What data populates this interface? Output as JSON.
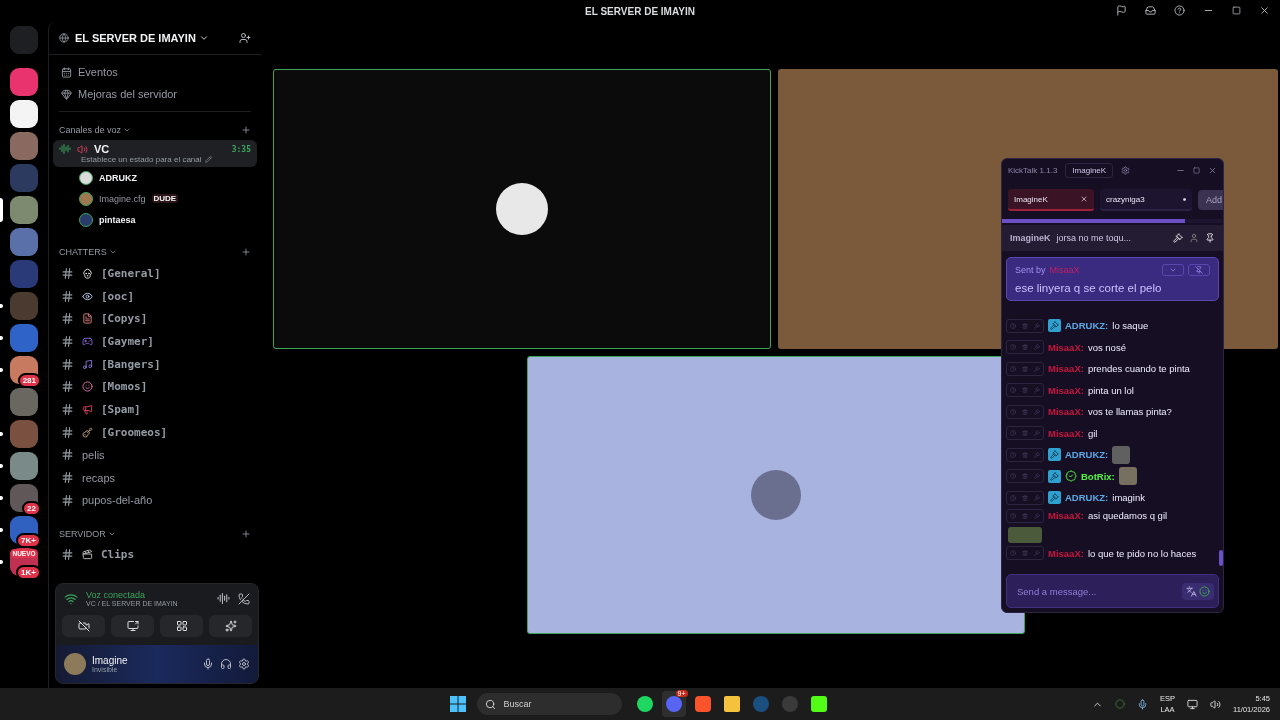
{
  "titlebar": {
    "title": "EL SERVER DE IMAYIN"
  },
  "servers": [
    {
      "selected": false,
      "unread": false
    },
    {
      "selected": false,
      "unread": false
    },
    {
      "selected": false,
      "unread": false
    },
    {
      "selected": false,
      "unread": false
    },
    {
      "selected": true,
      "unread": false
    },
    {
      "selected": false,
      "unread": false
    },
    {
      "selected": false,
      "unread": false
    },
    {
      "selected": false,
      "unread": true
    },
    {
      "selected": false,
      "unread": true
    },
    {
      "selected": false,
      "unread": true,
      "badge": "281"
    },
    {
      "selected": false,
      "unread": false
    },
    {
      "selected": false,
      "unread": true
    },
    {
      "selected": false,
      "unread": true
    },
    {
      "selected": false,
      "unread": true,
      "badge": "22"
    },
    {
      "selected": false,
      "unread": true,
      "badge": "7K+"
    },
    {
      "selected": false,
      "unread": true,
      "badge": "1K+",
      "tag": "NUEVO"
    }
  ],
  "server": {
    "name": "EL SERVER DE IMAYIN",
    "menu": [
      {
        "kind": "events",
        "label": "Eventos"
      },
      {
        "kind": "boost",
        "label": "Mejoras del servidor"
      }
    ]
  },
  "voice_category": {
    "title": "Canales de voz",
    "channel": {
      "name": "VC",
      "time": "3:35",
      "status": "Establece un estado para el canal"
    },
    "members": [
      {
        "name": "ADRUKZ",
        "dim": false
      },
      {
        "name": "Imagine.cfg",
        "dim": true,
        "tag": "DUDE"
      },
      {
        "name": "pintaesa",
        "dim": false
      }
    ]
  },
  "categories": [
    {
      "title": "CHATTERS",
      "channels": [
        {
          "name": "[General]",
          "kind": "skull"
        },
        {
          "name": "[ooc]",
          "kind": "eyes"
        },
        {
          "name": "[Copys]",
          "kind": "doc"
        },
        {
          "name": "[Gaymer]",
          "kind": "gamepad"
        },
        {
          "name": "[Bangers]",
          "kind": "music"
        },
        {
          "name": "[Momos]",
          "kind": "face"
        },
        {
          "name": "[Spam]",
          "kind": "megaphone"
        },
        {
          "name": "[Groomeos]",
          "kind": "guitar"
        },
        {
          "name": "pelis",
          "kind": "none"
        },
        {
          "name": "recaps",
          "kind": "none"
        },
        {
          "name": "pupos-del-año",
          "kind": "none"
        }
      ]
    },
    {
      "title": "SERVIDOR",
      "channels": [
        {
          "name": "Clips",
          "kind": "clapper"
        }
      ]
    }
  ],
  "voice_panel": {
    "status": "Voz conectada",
    "location": "VC / EL SERVER DE IMAYIN"
  },
  "user_panel": {
    "name": "Imagine",
    "status": "Invisible"
  },
  "stream_tiles": [
    {
      "kind": "avatar",
      "speaking": true
    },
    {
      "kind": "brown",
      "speaking": false
    },
    {
      "kind": "photo",
      "speaking": true
    }
  ],
  "chat_window": {
    "title": "KickTalk 1.1.3",
    "user": "ImagineK",
    "tabs": [
      {
        "label": "ImagineK",
        "selected": true
      },
      {
        "label": "crazyniga3",
        "selected": false
      }
    ],
    "add_button": "Add",
    "pinned": {
      "user": "ImagineK",
      "text": "jorsa no me toqu..."
    },
    "highlight": {
      "prefix": "Sent by",
      "user": "MisaaX",
      "text": "ese linyera q se corte el pelo"
    },
    "messages": [
      {
        "user": "ADRUKZ:",
        "color": "#5aa9e6",
        "moderator": true,
        "verified": false,
        "kind": "text",
        "text": "lo saque"
      },
      {
        "user": "MisaaX:",
        "color": "#c8143c",
        "moderator": false,
        "verified": false,
        "kind": "text",
        "text": "vos nosé"
      },
      {
        "user": "MisaaX:",
        "color": "#c8143c",
        "moderator": false,
        "verified": false,
        "kind": "text",
        "text": "prendes cuando te pinta"
      },
      {
        "user": "MisaaX:",
        "color": "#c8143c",
        "moderator": false,
        "verified": false,
        "kind": "text",
        "text": "pinta un lol"
      },
      {
        "user": "MisaaX:",
        "color": "#c8143c",
        "moderator": false,
        "verified": false,
        "kind": "text",
        "text": "vos te llamas pinta?"
      },
      {
        "user": "MisaaX:",
        "color": "#c8143c",
        "moderator": false,
        "verified": false,
        "kind": "text",
        "text": "gil"
      },
      {
        "user": "ADRUKZ:",
        "color": "#5aa9e6",
        "moderator": true,
        "verified": false,
        "kind": "emote"
      },
      {
        "user": "BotRix:",
        "color": "#54f542",
        "moderator": true,
        "verified": true,
        "kind": "emote"
      },
      {
        "user": "ADRUKZ:",
        "color": "#5aa9e6",
        "moderator": true,
        "verified": false,
        "kind": "text",
        "text": "imagink"
      },
      {
        "user": "MisaaX:",
        "color": "#c8143c",
        "moderator": false,
        "verified": false,
        "kind": "text_emote",
        "text": "asi quedamos q gil"
      },
      {
        "user": "MisaaX:",
        "color": "#c8143c",
        "moderator": false,
        "verified": false,
        "kind": "text",
        "text": "lo que te pido no lo haces"
      }
    ],
    "input": {
      "placeholder": "Send a message..."
    }
  },
  "taskbar": {
    "search": {
      "placeholder": "Buscar"
    },
    "apps": [
      {
        "kind": "spotify",
        "active": false
      },
      {
        "kind": "discord",
        "badge": "9+",
        "active": true
      },
      {
        "kind": "brave",
        "active": false
      },
      {
        "kind": "folder",
        "active": false
      },
      {
        "kind": "steam",
        "active": false
      },
      {
        "kind": "obs",
        "active": false
      },
      {
        "kind": "kick",
        "active": false
      }
    ],
    "language": "ESP",
    "layout": "LAA",
    "time": "5:45",
    "date": "11/01/2026"
  }
}
